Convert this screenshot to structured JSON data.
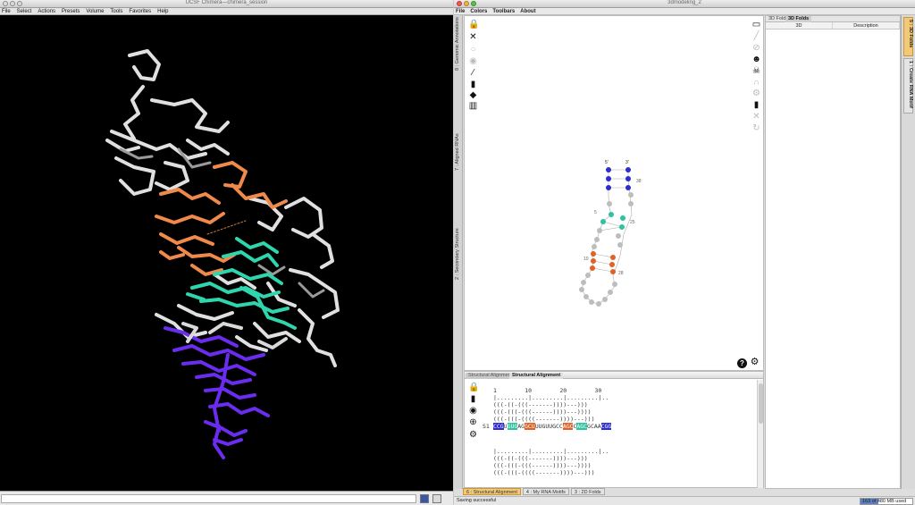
{
  "chimera": {
    "title": "UCSF Chimera—chimera_session",
    "menu": [
      "File",
      "Select",
      "Actions",
      "Presets",
      "Volume",
      "Tools",
      "Favorites",
      "Help"
    ]
  },
  "modeling": {
    "title": "3dmodeling_2",
    "menu": [
      "File",
      "Colors",
      "Toolbars",
      "About"
    ],
    "left_tabs": [
      "8 : Genomic Annotations",
      "7 : Aligned RNAs",
      "2 : Secondary Structure"
    ],
    "toolbar_left": [
      "lock-icon",
      "collapse-icon",
      "circle-icon",
      "eye-icon",
      "wand-icon",
      "paintbrush-icon",
      "tag-icon",
      "bar-chart-icon"
    ],
    "toolbar_right": [
      "window-icon",
      "pen-icon",
      "prohibit-icon",
      "smile-icon",
      "skull-icon",
      "magnet-icon",
      "gears-icon",
      "paintbrush-icon",
      "collapse-icon",
      "refresh-icon"
    ],
    "structure_labels": {
      "five_prime": "5'",
      "three_prime": "3'",
      "n38": "38",
      "n5": "5",
      "n25": "25",
      "n10": "10",
      "n28": "28"
    },
    "accent_colors": {
      "purple": "#2c2cd0",
      "teal": "#2bc3a0",
      "orange": "#e06226",
      "gray": "#bdbdbd"
    },
    "structural_alignment": {
      "tabs": [
        "Structural Alignment",
        "Structural Alignment"
      ],
      "ruler_numbers": "1        10        20        30",
      "ruler_marks": "|.........|.........|.........|..",
      "structures": [
        "(((-((-(((-------))))---)))",
        "(((-(((-(((------))))---))))",
        "(((-(((-((((-------))))---)))"
      ],
      "seq_label": "S1",
      "sequence": [
        {
          "c": "C",
          "k": "p"
        },
        {
          "c": "C",
          "k": "p"
        },
        {
          "c": "G",
          "k": "p"
        },
        {
          "c": "U",
          "k": "n"
        },
        {
          "c": "G",
          "k": "t"
        },
        {
          "c": "U",
          "k": "t"
        },
        {
          "c": "G",
          "k": "t"
        },
        {
          "c": "A",
          "k": "n"
        },
        {
          "c": "G",
          "k": "n"
        },
        {
          "c": "G",
          "k": "o"
        },
        {
          "c": "C",
          "k": "o"
        },
        {
          "c": "U",
          "k": "o"
        },
        {
          "c": "U",
          "k": "n"
        },
        {
          "c": "U",
          "k": "n"
        },
        {
          "c": "G",
          "k": "n"
        },
        {
          "c": "U",
          "k": "n"
        },
        {
          "c": "U",
          "k": "n"
        },
        {
          "c": "G",
          "k": "n"
        },
        {
          "c": "C",
          "k": "n"
        },
        {
          "c": "C",
          "k": "n"
        },
        {
          "c": "A",
          "k": "o"
        },
        {
          "c": "G",
          "k": "o"
        },
        {
          "c": "C",
          "k": "o"
        },
        {
          "c": "C",
          "k": "n"
        },
        {
          "c": "A",
          "k": "t"
        },
        {
          "c": "G",
          "k": "t"
        },
        {
          "c": "C",
          "k": "t"
        },
        {
          "c": "G",
          "k": "n"
        },
        {
          "c": "C",
          "k": "n"
        },
        {
          "c": "A",
          "k": "n"
        },
        {
          "c": "A",
          "k": "n"
        },
        {
          "c": "C",
          "k": "p"
        },
        {
          "c": "G",
          "k": "p"
        },
        {
          "c": "G",
          "k": "p"
        }
      ],
      "icons": [
        "lock-icon",
        "paintbrush-icon",
        "eye-icon",
        "export-icon",
        "gears-icon"
      ]
    },
    "bottom_tabs": [
      "6 : Structural Alignment",
      "4 : My RNA Motifs",
      "3 : 2D Folds"
    ],
    "status": "Saving successful",
    "memory": "163 of 480 MB used",
    "memory_fraction": 0.34,
    "folds_panel": {
      "tabs": [
        "3D Folds",
        "3D Folds"
      ],
      "columns": [
        "3D",
        "Description"
      ]
    },
    "right_tabs": [
      "5 : 3D Folds",
      "1 : Create RNA Motif"
    ]
  }
}
